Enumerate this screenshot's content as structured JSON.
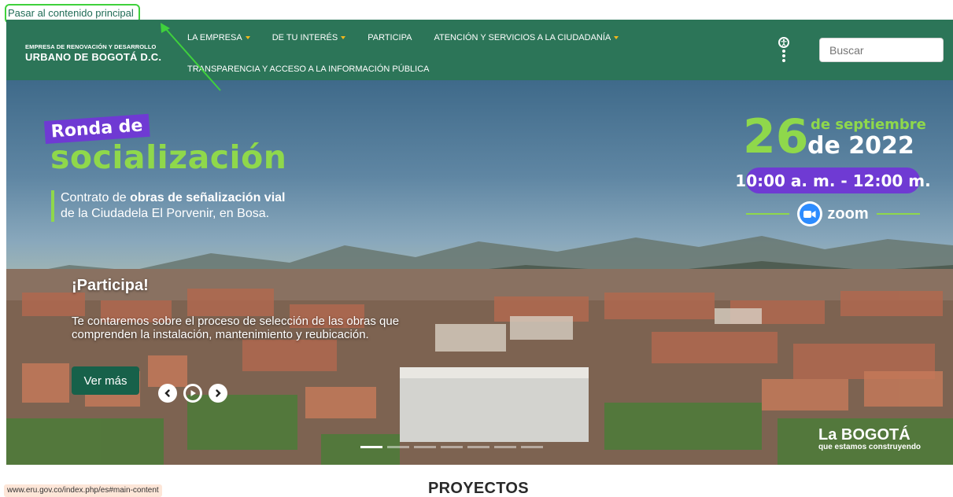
{
  "skip_link": "Pasar al contenido principal",
  "brand": {
    "line1": "EMPRESA DE RENOVACIÓN Y DESARROLLO",
    "line2": "URBANO DE BOGOTÁ D.C."
  },
  "nav": {
    "items": [
      {
        "label": "LA EMPRESA",
        "dropdown": true
      },
      {
        "label": "DE TU INTERÉS",
        "dropdown": true
      },
      {
        "label": "PARTICIPA",
        "dropdown": false
      },
      {
        "label": "ATENCIÓN Y SERVICIOS A LA CIUDADANÍA",
        "dropdown": true
      },
      {
        "label": "TRANSPARENCIA Y ACCESO A LA INFORMACIÓN PÚBLICA",
        "dropdown": false
      }
    ]
  },
  "search": {
    "placeholder": "Buscar"
  },
  "hero": {
    "ronda": "Ronda de",
    "socializacion": "socialización",
    "contrato_pre": "Contrato de ",
    "contrato_bold": "obras de señalización vial",
    "contrato_line2": "de la Ciudadela El Porvenir, en Bosa.",
    "date_num": "26",
    "date_line1": "de septiembre",
    "date_line2": "de 2022",
    "time": "10:00 a. m. - 12:00 m.",
    "zoom_label": "zoom",
    "participa": "¡Participa!",
    "description": "Te contaremos sobre el proceso de selección de las obras que comprenden la instalación, mantenimiento y reubicación.",
    "cta": "Ver más",
    "logo_line1": "La BOGOTÁ",
    "logo_line2": "que estamos construyendo"
  },
  "status_url": "www.eru.gov.co/index.php/es#main-content",
  "section_title": "PROYECTOS",
  "colors": {
    "header_bg": "#2c7558",
    "accent_green": "#8fd84b",
    "accent_purple": "#6f3ad3",
    "caret": "#f2b81b",
    "annotation": "#3fd13c"
  },
  "icons": [
    "accessibility-icon",
    "prev-icon",
    "play-icon",
    "next-icon",
    "zoom-camera-icon"
  ]
}
